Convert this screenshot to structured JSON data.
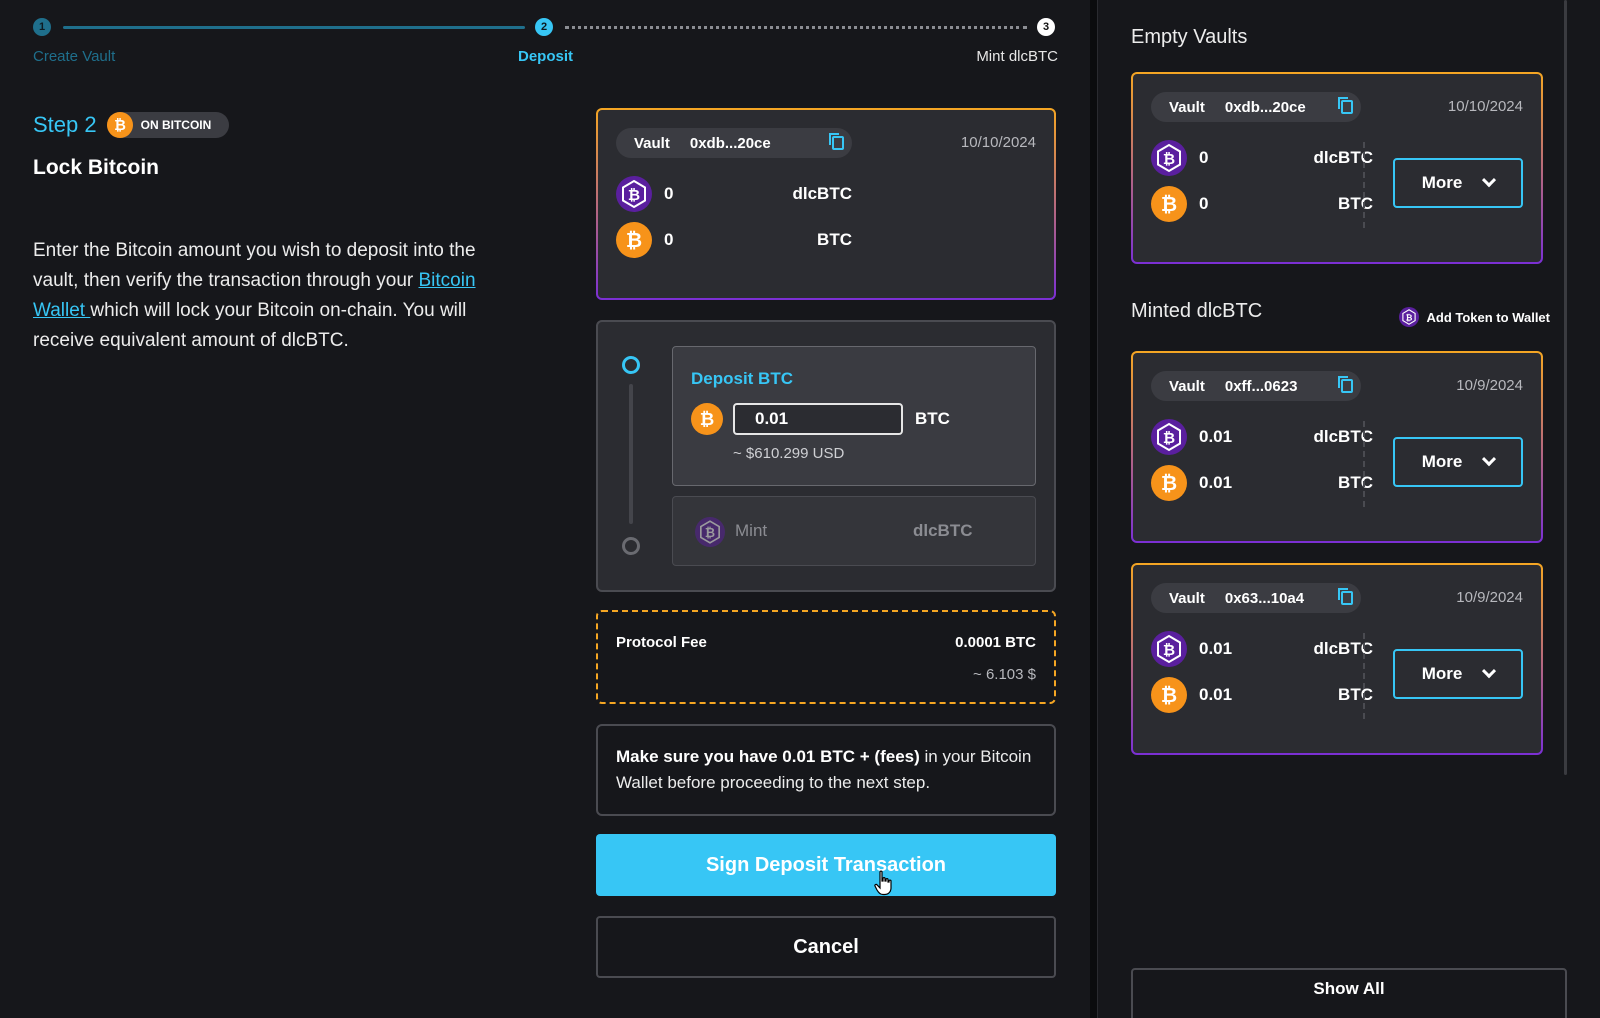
{
  "stepper": {
    "steps": [
      {
        "num": "1",
        "label": "Create Vault"
      },
      {
        "num": "2",
        "label": "Deposit"
      },
      {
        "num": "3",
        "label": "Mint dlcBTC"
      }
    ]
  },
  "step_info": {
    "step_label": "Step 2",
    "badge": "ON BITCOIN",
    "heading": "Lock Bitcoin",
    "desc_before": "Enter the Bitcoin amount you wish to deposit into the vault, then verify the transaction through your ",
    "desc_link": "Bitcoin Wallet ",
    "desc_after": "which will lock your Bitcoin on-chain. You will receive equivalent amount of dlcBTC."
  },
  "current_vault": {
    "vault_label": "Vault",
    "vault_id": "0xdb...20ce",
    "date": "10/10/2024",
    "dlcbtc_amount": "0",
    "dlcbtc_unit": "dlcBTC",
    "btc_amount": "0",
    "btc_unit": "BTC"
  },
  "deposit": {
    "title": "Deposit BTC",
    "amount": "0.01",
    "unit": "BTC",
    "usd": "~ $610.299 USD",
    "mint_label": "Mint",
    "mint_unit": "dlcBTC"
  },
  "fee": {
    "label": "Protocol Fee",
    "value": "0.0001 BTC",
    "usd": "~ 6.103 $"
  },
  "note": {
    "bold": "Make sure you have 0.01 BTC + (fees)",
    "rest": " in your Bitcoin Wallet before proceeding to the next step."
  },
  "buttons": {
    "sign": "Sign Deposit Transaction",
    "cancel": "Cancel",
    "show_all": "Show All"
  },
  "empty_vaults": {
    "title": "Empty Vaults",
    "vaults": [
      {
        "vault_label": "Vault",
        "vault_id": "0xdb...20ce",
        "date": "10/10/2024",
        "dlcbtc": "0",
        "dlcbtc_unit": "dlcBTC",
        "btc": "0",
        "btc_unit": "BTC",
        "more": "More"
      }
    ]
  },
  "minted": {
    "title": "Minted dlcBTC",
    "add_token": "Add Token to Wallet",
    "vaults": [
      {
        "vault_label": "Vault",
        "vault_id": "0xff...0623",
        "date": "10/9/2024",
        "dlcbtc": "0.01",
        "dlcbtc_unit": "dlcBTC",
        "btc": "0.01",
        "btc_unit": "BTC",
        "more": "More"
      },
      {
        "vault_label": "Vault",
        "vault_id": "0x63...10a4",
        "date": "10/9/2024",
        "dlcbtc": "0.01",
        "dlcbtc_unit": "dlcBTC",
        "btc": "0.01",
        "btc_unit": "BTC",
        "more": "More"
      }
    ]
  },
  "colors": {
    "accent": "#37c6f5",
    "btc_orange": "#f7931a",
    "dlc_purple": "#5a1f9e",
    "background": "#16171b",
    "card": "#2b2c31"
  }
}
